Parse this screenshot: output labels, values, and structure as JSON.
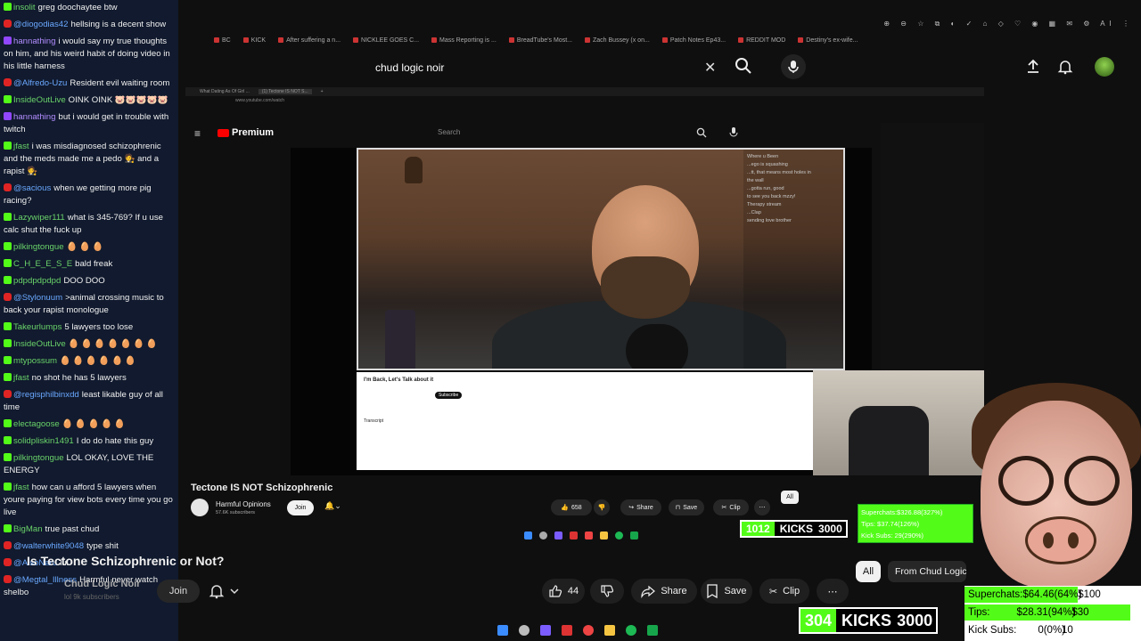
{
  "chat": {
    "messages": [
      {
        "platform": "kick",
        "user": "insolit",
        "text": "greg doochaytee btw"
      },
      {
        "platform": "yt",
        "user": "@diogodias42",
        "text": "hellsing is a decent show"
      },
      {
        "platform": "tw",
        "user": "hannathing",
        "text": "i would say my true thoughts on him, and his weird habit of doing video in his little harness"
      },
      {
        "platform": "yt",
        "user": "@Alfredo-Uzu",
        "text": "Resident evil waiting room"
      },
      {
        "platform": "kick",
        "user": "InsideOutLive",
        "text": "OINK OINK 🐷🐷🐷🐷🐷"
      },
      {
        "platform": "tw",
        "user": "hannathing",
        "text": "but i would get in trouble with twitch"
      },
      {
        "platform": "kick",
        "user": "jfast",
        "text": "i was misdiagnosed schizophrenic and the meds made me a pedo 🧑‍⚖️ and a rapist 🧑‍⚖️"
      },
      {
        "platform": "yt",
        "user": "@sacious",
        "text": "when we getting more pig racing?"
      },
      {
        "platform": "kick",
        "user": "Lazywiper111",
        "text": "what is 345-769? If u use calc shut the fuck up"
      },
      {
        "platform": "kick",
        "user": "pilkingtongue",
        "text": "🥚 🥚 🥚"
      },
      {
        "platform": "kick",
        "user": "C_H_E_E_S_E",
        "text": "bald freak"
      },
      {
        "platform": "kick",
        "user": "pdpdpdpdpd",
        "text": "DOO DOO"
      },
      {
        "platform": "yt",
        "user": "@Stylonuum",
        "text": ">animal crossing music to back your rapist monologue"
      },
      {
        "platform": "kick",
        "user": "Takeurlumps",
        "text": "5 lawyers too lose"
      },
      {
        "platform": "kick",
        "user": "InsideOutLive",
        "text": "🥚 🥚 🥚 🥚 🥚 🥚 🥚"
      },
      {
        "platform": "kick",
        "user": "mtypossum",
        "text": "🥚 🥚 🥚 🥚 🥚 🥚"
      },
      {
        "platform": "kick",
        "user": "jfast",
        "text": "no shot he has 5 lawyers"
      },
      {
        "platform": "yt",
        "user": "@regisphilbinxdd",
        "text": "least likable guy of all time"
      },
      {
        "platform": "kick",
        "user": "electagoose",
        "text": "🥚 🥚 🥚 🥚 🥚"
      },
      {
        "platform": "kick",
        "user": "solidpliskin1491",
        "text": "I do do hate this guy"
      },
      {
        "platform": "kick",
        "user": "pilkingtongue",
        "text": "LOL OKAY, LOVE THE ENERGY"
      },
      {
        "platform": "kick",
        "user": "jfast",
        "text": "how can u afford 5 lawyers when youre paying for view bots every time you go live"
      },
      {
        "platform": "kick",
        "user": "BigMan",
        "text": "true past chud"
      },
      {
        "platform": "yt",
        "user": "@walterwhite9048",
        "text": "type shit"
      },
      {
        "platform": "yt",
        "user": "@AlsoNaru",
        "text": "lul"
      },
      {
        "platform": "yt",
        "user": "@Megtal_Illness",
        "text": "Harmful never watch shelbo"
      }
    ]
  },
  "browser": {
    "bookmarks": [
      "BC",
      "KICK",
      "After suffering a n...",
      "NICKLEE GOES C...",
      "Mass Reporting is ...",
      "BreadTube's Most...",
      "Zach Bussey (x on...",
      "Patch Notes Ep43...",
      "REDDIT MOD",
      "Destiny's ex-wife..."
    ]
  },
  "search": {
    "query": "chud logic noir",
    "clear_label": "✕"
  },
  "inner": {
    "tabs": [
      "What Dating As Of Girl ...",
      "(1) Tectone IS NOT S...",
      "+"
    ],
    "url": "www.youtube.com/watch",
    "logo": "Premium",
    "search_placeholder": "Search",
    "video_overlay_chat": "Where u Been\n...ego is squashing\n...tt, that means most holes in\nthe wall\n...gotta run, good\nto see you back mzzy!\nTherapy stream\n...Clap\nsending love brother",
    "desc_title": "I'm Back, Let's Talk about it",
    "desc_sub": "Subscribe",
    "desc_text": "Transcript",
    "title": "Tectone IS NOT Schizophrenic",
    "channel": "Harmful Opinions",
    "subs": "57.6K subscribers",
    "join": "Join",
    "likes": "658",
    "share": "Share",
    "save": "Save",
    "clip": "Clip",
    "all": "All"
  },
  "outer": {
    "title": "Is Tectone Schizophrenic or Not?",
    "channel": "Chud Logic Noir",
    "subs": "lol 9k subscribers",
    "join": "Join",
    "likes": "44",
    "share": "Share",
    "save": "Save",
    "clip": "Clip",
    "all": "All",
    "from_chip": "From Chud Logic N"
  },
  "kicks_small": {
    "count": "1012",
    "label": "KICKS",
    "goal": "3000"
  },
  "kicks_big": {
    "count": "304",
    "label": "KICKS",
    "goal": "3000"
  },
  "superchats_small": {
    "superchats": "Superchats:$326.88(327%)",
    "tips": "Tips: $37.74(126%)",
    "kick_subs": "Kick Subs: 29(290%)"
  },
  "superchats": {
    "superchats_label": "Superchats:",
    "superchats_value": "$64.46(64%)",
    "superchats_goal": "$100",
    "superchats_progress": 0.64,
    "tips_label": "Tips:",
    "tips_value": "$28.31(94%)",
    "tips_goal": "$30",
    "tips_progress": 0.94,
    "kick_label": "Kick Subs:",
    "kick_value": "0(0%)",
    "kick_goal": "10",
    "kick_progress": 0
  },
  "colors": {
    "kick": "#53fc18",
    "yt": "#e02424",
    "brand_red": "#ff0000"
  }
}
